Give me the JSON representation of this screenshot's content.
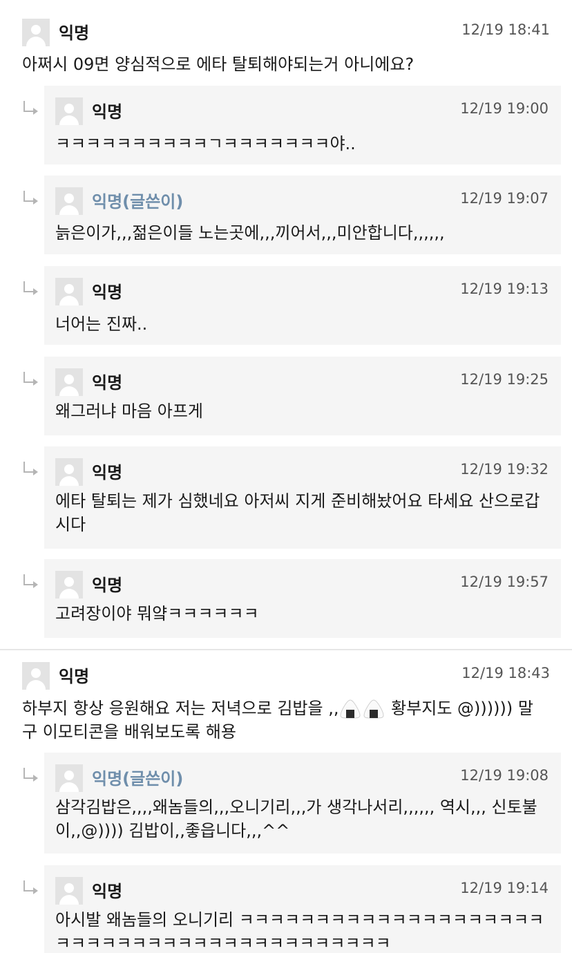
{
  "threads": [
    {
      "comment": {
        "name": "익명",
        "time": "12/19 18:41",
        "text": "아쩌시 09면 양심적으로 에타 탈퇴해야되는거 아니에요?"
      },
      "replies": [
        {
          "name": "익명",
          "time": "12/19 19:00",
          "text": "ㅋㅋㅋㅋㅋㅋㅋㅋㅋㅋㄱㅋㅋㅋㅋㅋㅋㅋ야..",
          "op": false
        },
        {
          "name": "익명(글쓴이)",
          "time": "12/19 19:07",
          "text": "늙은이가,,,젊은이들 노는곳에,,,끼어서,,,미안합니다,,,,,,",
          "op": true
        },
        {
          "name": "익명",
          "time": "12/19 19:13",
          "text": "너어는 진짜..",
          "op": false
        },
        {
          "name": "익명",
          "time": "12/19 19:25",
          "text": "왜그러냐 마음 아프게",
          "op": false
        },
        {
          "name": "익명",
          "time": "12/19 19:32",
          "text": "에타 탈퇴는 제가 심했네요 아저씨 지게 준비해놨어요 타세요 산으로갑시다",
          "op": false
        },
        {
          "name": "익명",
          "time": "12/19 19:57",
          "text": "고려장이야 뭐얔ㅋㅋㅋㅋㅋㅋ",
          "op": false
        }
      ]
    },
    {
      "comment": {
        "name": "익명",
        "time": "12/19 18:43",
        "text_before_emoji": "하부지 항상 응원해요 저는 저녁으로 김밥을 ,,",
        "emoji": "rice-ball-icon",
        "text_after_emoji": " 황부지도 @)))))) 말구 이모티콘을 배워보도록 해용"
      },
      "replies": [
        {
          "name": "익명(글쓴이)",
          "time": "12/19 19:08",
          "text": "삼각김밥은,,,,왜놈들의,,,오니기리,,,가 생각나서리,,,,,, 역시,,, 신토불이,,@)))) 김밥이,,좋읍니다,,,^^",
          "op": true
        },
        {
          "name": "익명",
          "time": "12/19 19:14",
          "text": "아시발 왜놈들의 오니기리 ㅋㅋㅋㅋㅋㅋㅋㅋㅋㅋㅋㅋㅋㅋㅋㅋㅋㅋㅋㅋㅋㅋㅋㅋㅋㅋㅋㅋㅋㅋㅋㅋㅋㅋㅋㅋㅋㅋㅋㅋㅋㅋ",
          "op": false
        }
      ]
    }
  ],
  "colors": {
    "op_name": "#6f8eab",
    "reply_background": "#f5f5f5",
    "avatar_background": "#e3e3e3"
  }
}
